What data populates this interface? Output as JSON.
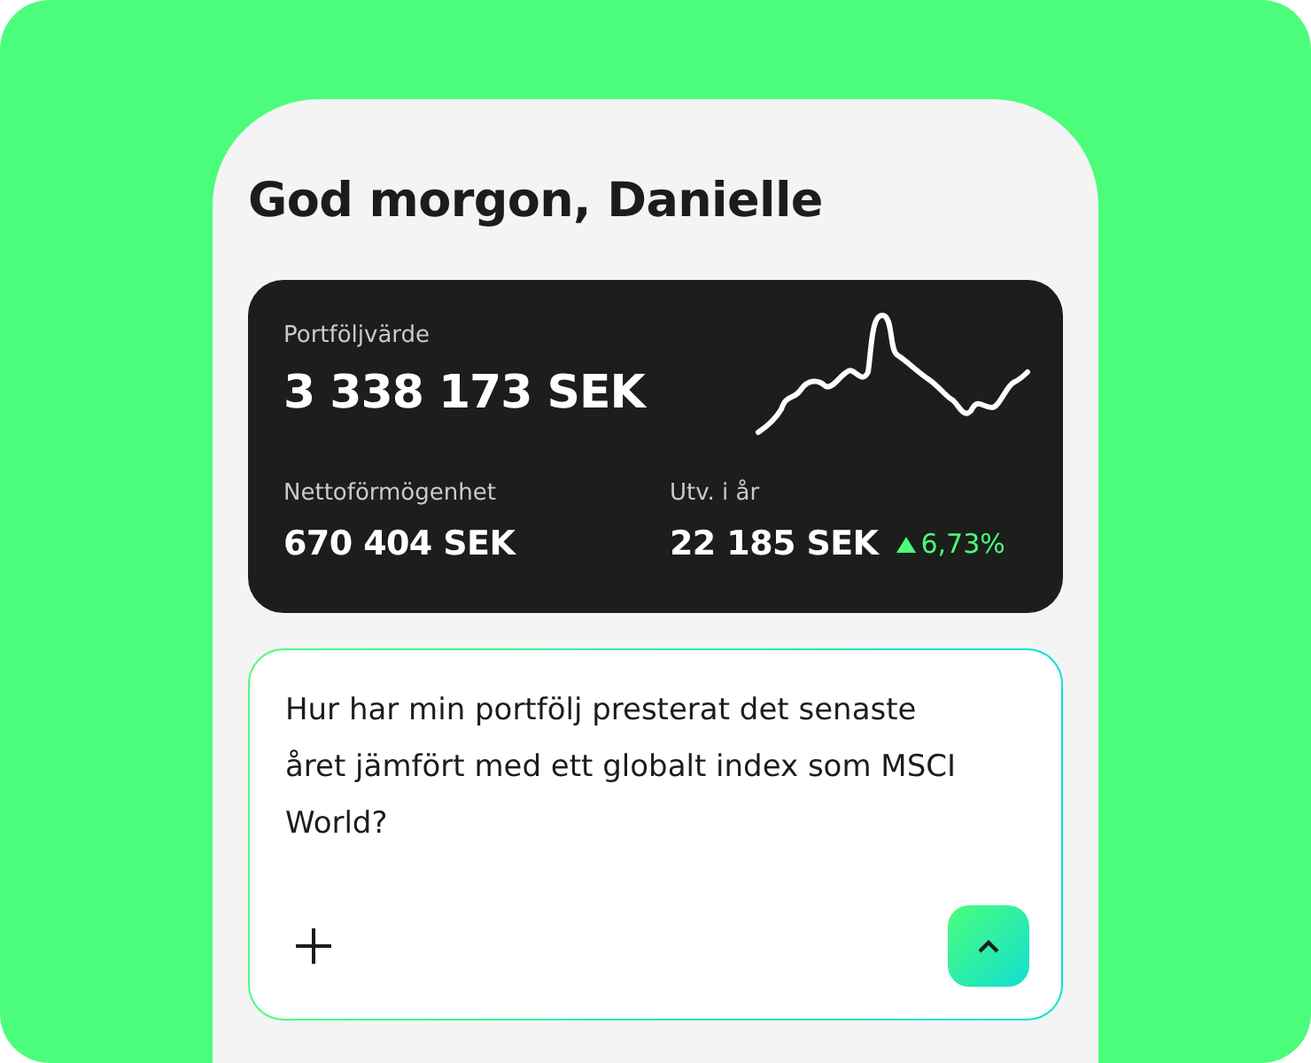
{
  "greeting": "God morgon, Danielle",
  "portfolio": {
    "label": "Portföljvärde",
    "value": "3 338 173 SEK"
  },
  "stats": [
    {
      "label": "Nettoförmögenhet",
      "value": "670 404 SEK"
    },
    {
      "label": "Utv. i år",
      "value": "22 185 SEK",
      "change": "6,73%"
    }
  ],
  "composer": {
    "value": "Hur har min portfölj presterat det senaste året jämfört med ett globalt index som MSCI World?"
  }
}
